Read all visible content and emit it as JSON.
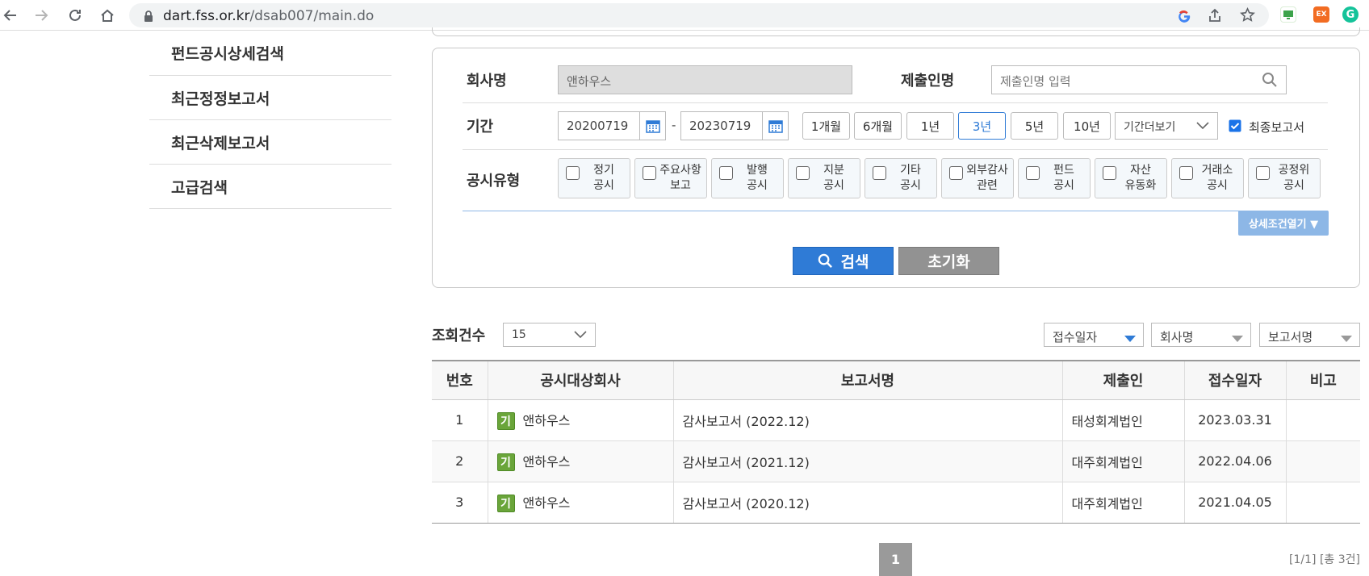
{
  "browser": {
    "url_host": "dart.fss.or.kr",
    "url_path": "/dsab007/main.do",
    "ext_ex": "EX",
    "ext_g": "G"
  },
  "left_menu": {
    "items": [
      "펀드공시상세검색",
      "최근정정보고서",
      "최근삭제보고서",
      "고급검색"
    ]
  },
  "search": {
    "company_label": "회사명",
    "company_value": "앤하우스",
    "submitter_label": "제출인명",
    "submitter_placeholder": "제출인명 입력",
    "period_label": "기간",
    "date_from": "20200719",
    "date_sep": "-",
    "date_to": "20230719",
    "period_buttons": [
      "1개월",
      "6개월",
      "1년",
      "3년",
      "5년",
      "10년"
    ],
    "period_active": "3년",
    "period_more": "기간더보기",
    "final_report_label": "최종보고서",
    "final_report_checked": true,
    "type_label": "공시유형",
    "types": [
      [
        "정기",
        "공시"
      ],
      [
        "주요사항",
        "보고"
      ],
      [
        "발행",
        "공시"
      ],
      [
        "지분",
        "공시"
      ],
      [
        "기타",
        "공시"
      ],
      [
        "외부감사",
        "관련"
      ],
      [
        "펀드",
        "공시"
      ],
      [
        "자산",
        "유동화"
      ],
      [
        "거래소",
        "공시"
      ],
      [
        "공정위",
        "공시"
      ]
    ],
    "detail_toggle": "상세조건열기 ▼",
    "search_button": "검색",
    "reset_button": "초기화"
  },
  "results": {
    "count_label": "조회건수",
    "page_size": "15",
    "sorts": [
      "접수일자",
      "회사명",
      "보고서명"
    ],
    "columns": [
      "번호",
      "공시대상회사",
      "보고서명",
      "제출인",
      "접수일자",
      "비고"
    ],
    "rows": [
      {
        "no": "1",
        "badge": "기",
        "company": "앤하우스",
        "report": "감사보고서 (2022.12)",
        "submitter": "태성회계법인",
        "date": "2023.03.31",
        "note": ""
      },
      {
        "no": "2",
        "badge": "기",
        "company": "앤하우스",
        "report": "감사보고서 (2021.12)",
        "submitter": "대주회계법인",
        "date": "2022.04.06",
        "note": ""
      },
      {
        "no": "3",
        "badge": "기",
        "company": "앤하우스",
        "report": "감사보고서 (2020.12)",
        "submitter": "대주회계법인",
        "date": "2021.04.05",
        "note": ""
      }
    ],
    "page": "1",
    "page_info": "[1/1] [총 3건]"
  },
  "colors": {
    "primary": "#2f7bd6",
    "badge": "#6aa53a",
    "visited_link": "#b0218f"
  }
}
